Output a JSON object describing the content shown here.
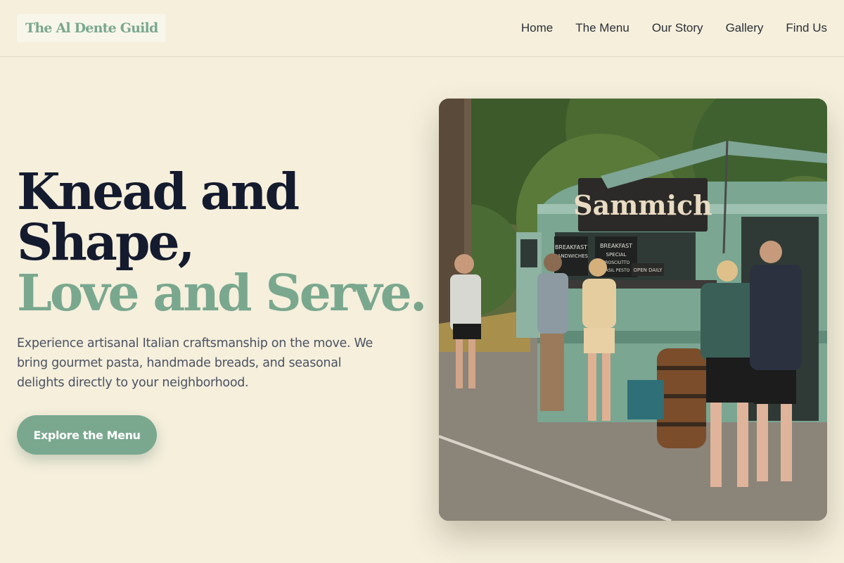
{
  "header": {
    "logo": "The Al Dente Guild",
    "nav": [
      "Home",
      "The Menu",
      "Our Story",
      "Gallery",
      "Find Us"
    ]
  },
  "hero": {
    "headline_line1": "Knead and",
    "headline_line2": "Shape,",
    "headline_accent": "Love and Serve.",
    "description": "Experience artisanal Italian craftsmanship on the move. We bring gourmet pasta, handmade breads, and seasonal delights directly to your neighborhood.",
    "cta_label": "Explore the Menu",
    "image": {
      "truck_sign": "Sammich",
      "board1": [
        "BREAKFAST",
        "SANDWICHES"
      ],
      "board2": [
        "BREAKFAST",
        "SPECIAL",
        "PROSCIUTTO",
        "BASIL PESTO"
      ],
      "board3": "OPEN DAILY"
    }
  },
  "colors": {
    "background": "#f5efdc",
    "accent": "#7aa88f",
    "headline": "#151b2e",
    "body_text": "#4b5262"
  }
}
